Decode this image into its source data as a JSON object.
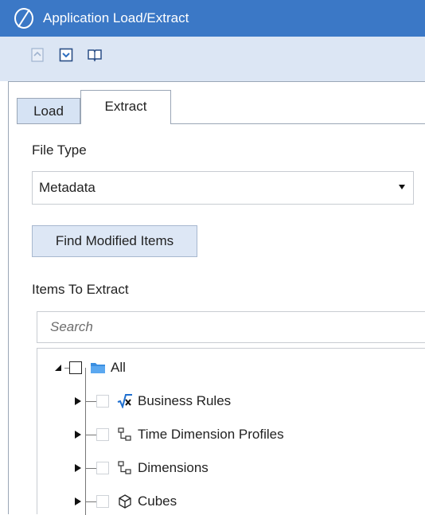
{
  "window": {
    "title": "Application Load/Extract",
    "logo_icon": "app-logo-icon"
  },
  "toolbar": {
    "buttons": [
      {
        "name": "import-icon"
      },
      {
        "name": "extract-icon"
      },
      {
        "name": "open-book-icon"
      }
    ]
  },
  "tabs": [
    {
      "label": "Load",
      "active": false
    },
    {
      "label": "Extract",
      "active": true
    }
  ],
  "form": {
    "file_type_label": "File Type",
    "file_type_value": "Metadata",
    "find_modified_label": "Find Modified Items",
    "items_label": "Items To Extract",
    "search_placeholder": "Search"
  },
  "tree": {
    "root": {
      "label": "All",
      "checked": false,
      "expanded": true,
      "icon": "folder-icon"
    },
    "children": [
      {
        "label": "Business Rules",
        "icon": "sqrt-x-icon",
        "checked": false
      },
      {
        "label": "Time Dimension Profiles",
        "icon": "hierarchy-icon",
        "checked": false
      },
      {
        "label": "Dimensions",
        "icon": "hierarchy-icon",
        "checked": false
      },
      {
        "label": "Cubes",
        "icon": "cube-icon",
        "checked": false
      }
    ]
  },
  "colors": {
    "title_bar": "#3b78c6",
    "toolbar": "#dce6f4",
    "tab_inactive": "#d6e3f4",
    "button": "#dde7f5"
  }
}
